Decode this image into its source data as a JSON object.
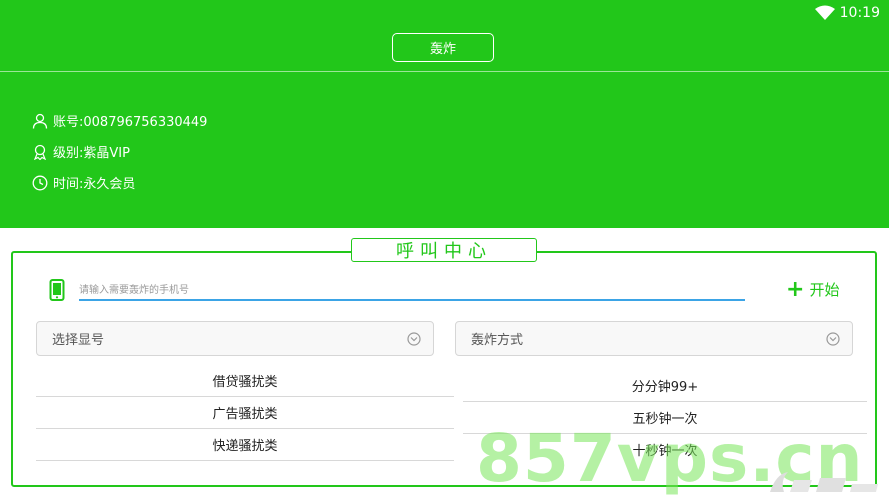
{
  "status_bar": {
    "time": "10:19",
    "wifi_icon": "wifi-icon"
  },
  "header": {
    "title_button": "轰炸",
    "account": "账号:008796756330449",
    "level": "级别:紫晶VIP",
    "time": "时间:永久会员"
  },
  "call_center": {
    "title": "呼叫中心",
    "phone_placeholder": "请输入需要轰炸的手机号",
    "phone_value": "",
    "start_label": "开始",
    "select_number": "选择显号",
    "bomb_mode": "轰炸方式",
    "left_options": [
      "借贷骚扰类",
      "广告骚扰类",
      "快递骚扰类"
    ],
    "right_options": [
      "分分钟99+",
      "五秒钟一次",
      "十秒钟一次"
    ]
  },
  "overlay": {
    "watermark": "857vps.cn"
  },
  "colors": {
    "primary_green": "#22c71a",
    "input_underline": "#3ba4e6"
  }
}
